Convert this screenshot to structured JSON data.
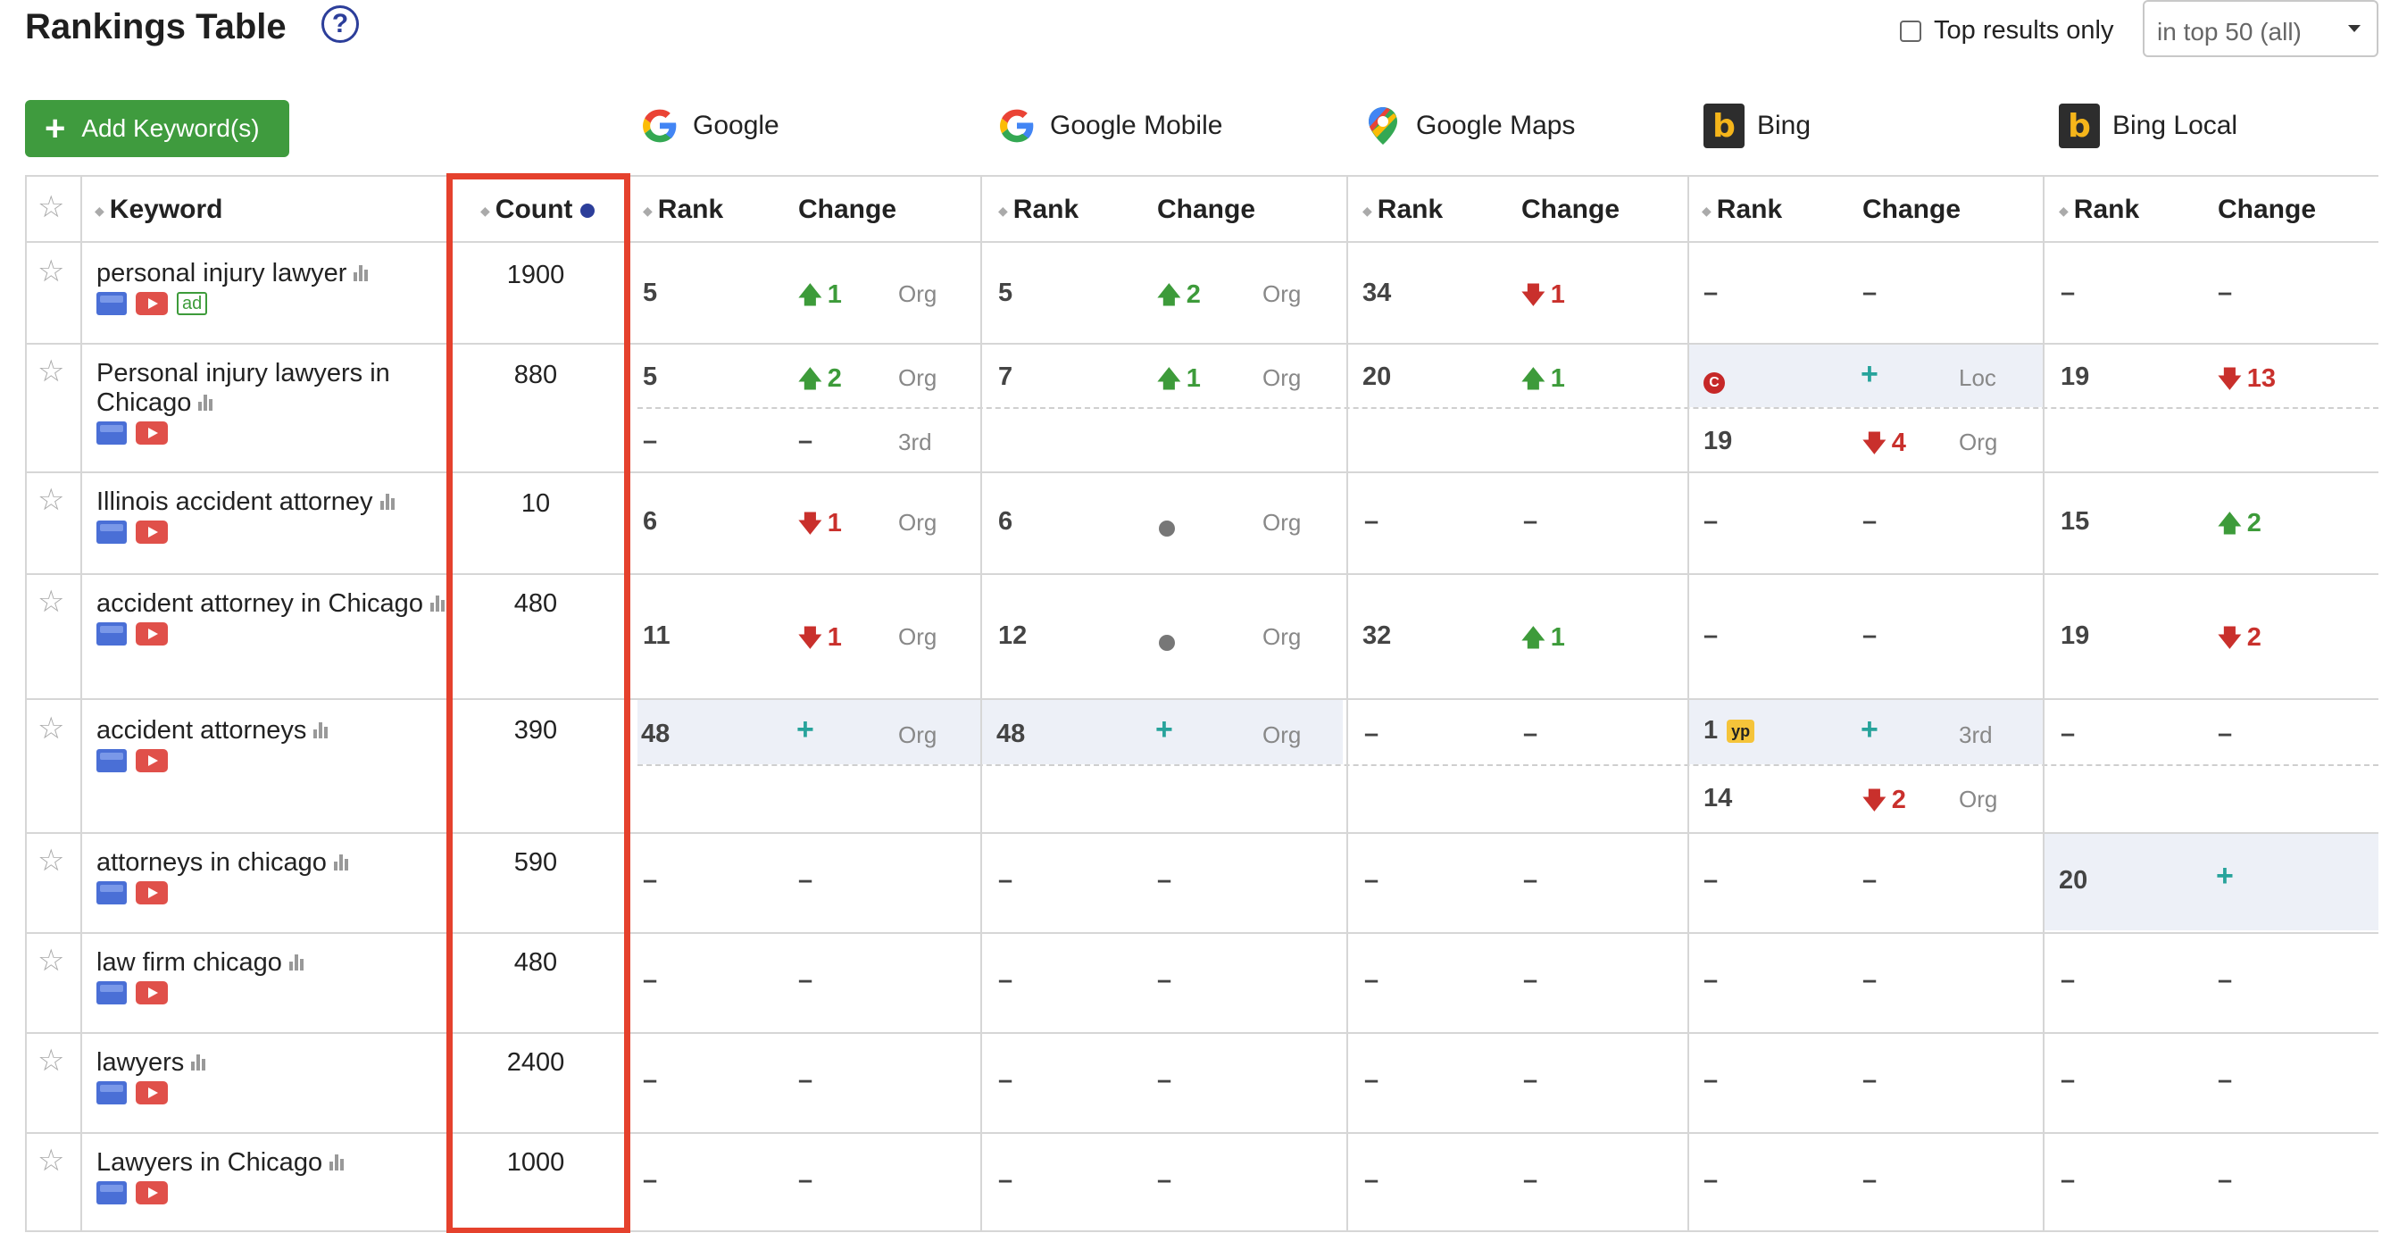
{
  "header": {
    "title": "Rankings Table",
    "help_symbol": "?",
    "top_results_label": "Top results only",
    "filter_select": "in top 50 (all)",
    "add_button": "Add Keyword(s)",
    "add_symbol": "+"
  },
  "engines": [
    {
      "name": "Google",
      "icon": "google-icon"
    },
    {
      "name": "Google Mobile",
      "icon": "google-icon"
    },
    {
      "name": "Google Maps",
      "icon": "google-maps-pin-icon"
    },
    {
      "name": "Bing",
      "icon": "bing-icon"
    },
    {
      "name": "Bing Local",
      "icon": "bing-icon"
    }
  ],
  "columns": {
    "keyword": "Keyword",
    "count": "Count",
    "rank": "Rank",
    "change": "Change"
  },
  "colors": {
    "accent_green": "#3f9b3e",
    "up": "#3d9b3a",
    "down": "#c9302c",
    "new": "#27a39b",
    "highlight_box": "#e5412d",
    "highlight_row": "#edf0f7"
  },
  "symbols": {
    "dash": "–",
    "new": "+",
    "star": "☆",
    "up": "🡅",
    "down": "🡇",
    "bing_letter": "b",
    "c_badge": "C",
    "yp_badge": "yp",
    "ad_badge": "ad"
  },
  "rows": [
    {
      "keyword": "personal injury lawyer",
      "count": "1900",
      "ad": true,
      "g_rank": "5",
      "g_change": "1",
      "g_type": "Org",
      "gm_rank": "5",
      "gm_change": "2",
      "gm_type": "Org",
      "maps_rank": "34",
      "maps_change": "1"
    },
    {
      "keyword": "Personal injury lawyers in Chicago",
      "count": "880",
      "g_rank": "5",
      "g_change": "2",
      "g_type": "Org",
      "g_rank2": "–",
      "g_change2": "–",
      "g_type2": "3rd",
      "gm_rank": "7",
      "gm_change": "1",
      "gm_type": "Org",
      "maps_rank": "20",
      "maps_change": "1",
      "bing_type": "Loc",
      "bing_rank2": "19",
      "bing_change2": "4",
      "bing_type2": "Org",
      "bl_rank": "19",
      "bl_change": "13"
    },
    {
      "keyword": "Illinois accident attorney",
      "count": "10",
      "g_rank": "6",
      "g_change": "1",
      "g_type": "Org",
      "gm_rank": "6",
      "gm_type": "Org",
      "bl_rank": "15",
      "bl_change": "2"
    },
    {
      "keyword": "accident attorney in Chicago",
      "count": "480",
      "g_rank": "11",
      "g_change": "1",
      "g_type": "Org",
      "gm_rank": "12",
      "gm_type": "Org",
      "maps_rank": "32",
      "maps_change": "1",
      "bl_rank": "19",
      "bl_change": "2"
    },
    {
      "keyword": "accident attorneys",
      "count": "390",
      "g_rank": "48",
      "g_type": "Org",
      "gm_rank": "48",
      "gm_type": "Org",
      "bing_rank": "1",
      "bing_type": "3rd",
      "bing_rank2": "14",
      "bing_change2": "2",
      "bing_type2": "Org"
    },
    {
      "keyword": "attorneys in chicago",
      "count": "590",
      "bl_rank": "20"
    },
    {
      "keyword": "law firm chicago",
      "count": "480"
    },
    {
      "keyword": "lawyers",
      "count": "2400"
    },
    {
      "keyword": "Lawyers in Chicago",
      "count": "1000"
    }
  ]
}
